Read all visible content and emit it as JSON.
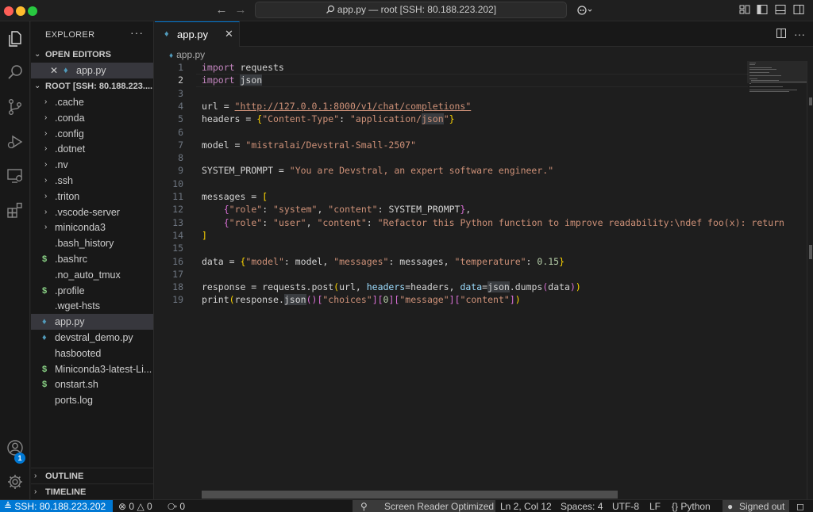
{
  "window": {
    "title": "app.py — root [SSH: 80.188.223.202]"
  },
  "sidebar": {
    "title": "EXPLORER",
    "more": "···",
    "open_editors": {
      "header": "OPEN EDITORS",
      "items": [
        {
          "label": "app.py",
          "close": "✕"
        }
      ]
    },
    "root": {
      "header": "ROOT [SSH: 80.188.223....",
      "folders": [
        ".cache",
        ".conda",
        ".config",
        ".dotnet",
        ".nv",
        ".ssh",
        ".triton",
        ".vscode-server",
        "miniconda3"
      ],
      "files": [
        {
          "label": ".bash_history",
          "icon": "none"
        },
        {
          "label": ".bashrc",
          "icon": "$"
        },
        {
          "label": ".no_auto_tmux",
          "icon": "none"
        },
        {
          "label": ".profile",
          "icon": "$"
        },
        {
          "label": ".wget-hsts",
          "icon": "none"
        },
        {
          "label": "app.py",
          "icon": "python",
          "active": true
        },
        {
          "label": "devstral_demo.py",
          "icon": "python"
        },
        {
          "label": "hasbooted",
          "icon": "none"
        },
        {
          "label": "Miniconda3-latest-Li...",
          "icon": "$"
        },
        {
          "label": "onstart.sh",
          "icon": "$"
        },
        {
          "label": "ports.log",
          "icon": "none"
        }
      ]
    },
    "outline": "OUTLINE",
    "timeline": "TIMELINE"
  },
  "activity": {
    "accounts_badge": "1"
  },
  "editor": {
    "tab_label": "app.py",
    "tab_close": "✕",
    "breadcrumb": "app.py",
    "current_line": 2,
    "line_numbers": [
      "1",
      "2",
      "3",
      "4",
      "5",
      "6",
      "7",
      "8",
      "9",
      "10",
      "11",
      "12",
      "13",
      "14",
      "15",
      "16",
      "17",
      "18",
      "19"
    ],
    "code": {
      "l1_kw": "import",
      "l1_rest": " requests",
      "l2_kw": "import",
      "l2_rest": "json",
      "l4_a": "url = ",
      "l4_url": "\"http://127.0.0.1:8000/v1/chat/completions\"",
      "l5_a": "headers = ",
      "l5_b": "{",
      "l5_c": "\"Content-Type\"",
      "l5_d": ": ",
      "l5_e": "\"application/",
      "l5_f": "json",
      "l5_g": "\"",
      "l5_h": "}",
      "l7_a": "model = ",
      "l7_b": "\"mistralai/Devstral-Small-2507\"",
      "l9_a": "SYSTEM_PROMPT = ",
      "l9_b": "\"You are Devstral, an expert software engineer.\"",
      "l11_a": "messages = ",
      "l11_b": "[",
      "l12_a": "    ",
      "l12_b": "{",
      "l12_c": "\"role\"",
      "l12_d": ": ",
      "l12_e": "\"system\"",
      "l12_f": ", ",
      "l12_g": "\"content\"",
      "l12_h": ": SYSTEM_PROMPT",
      "l12_i": "}",
      "l12_j": ",",
      "l13_a": "    ",
      "l13_b": "{",
      "l13_c": "\"role\"",
      "l13_d": ": ",
      "l13_e": "\"user\"",
      "l13_f": ", ",
      "l13_g": "\"content\"",
      "l13_h": ": ",
      "l13_i": "\"Refactor this Python function to improve readability:\\ndef foo(x): return",
      "l14_a": "]",
      "l16_a": "data = ",
      "l16_b": "{",
      "l16_c": "\"model\"",
      "l16_d": ": model, ",
      "l16_e": "\"messages\"",
      "l16_f": ": messages, ",
      "l16_g": "\"temperature\"",
      "l16_h": ": ",
      "l16_i": "0.15",
      "l16_j": "}",
      "l18_a": "response = requests.post",
      "l18_b": "(",
      "l18_c": "url, ",
      "l18_d": "headers",
      "l18_e": "=headers, ",
      "l18_f": "data",
      "l18_g": "=",
      "l18_h": "json",
      "l18_i": ".dumps",
      "l18_j": "(",
      "l18_k": "data",
      "l18_l": ")",
      "l18_m": ")",
      "l19_a": "print",
      "l19_b": "(",
      "l19_c": "response.",
      "l19_d": "json",
      "l19_e": "()",
      "l19_f": "[",
      "l19_g": "\"choices\"",
      "l19_h": "][",
      "l19_i": "0",
      "l19_j": "][",
      "l19_k": "\"message\"",
      "l19_l": "][",
      "l19_m": "\"content\"",
      "l19_n": "]",
      "l19_o": ")"
    }
  },
  "statusbar": {
    "remote": "SSH: 80.188.223.202",
    "errors": "0",
    "warnings": "0",
    "ports": "0",
    "screen_reader": "Screen Reader Optimized",
    "position": "Ln 2, Col 12",
    "spaces": "Spaces: 4",
    "encoding": "UTF-8",
    "eol": "LF",
    "language": "Python",
    "signed_out": "Signed out"
  },
  "colors": {
    "accent": "#0078d4",
    "keyword": "#c586c0",
    "string": "#ce9178",
    "bracket": "#ffd700"
  },
  "icons": [
    "explorer-icon",
    "search-icon",
    "source-control-icon",
    "run-debug-icon",
    "remote-explorer-icon",
    "extensions-icon",
    "accounts-icon",
    "settings-gear-icon"
  ]
}
